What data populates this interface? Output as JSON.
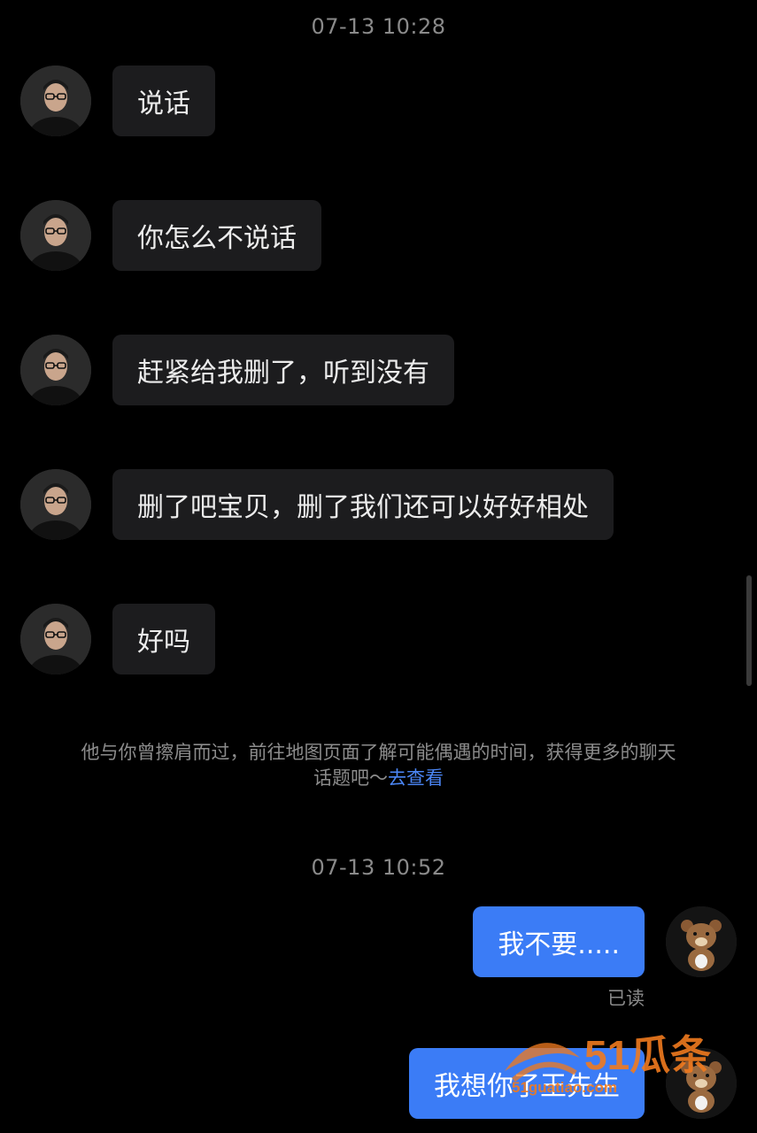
{
  "timestamps": {
    "first": "07-13 10:28",
    "second": "07-13 10:52"
  },
  "received_messages": [
    {
      "text": "说话"
    },
    {
      "text": "你怎么不说话"
    },
    {
      "text": "赶紧给我删了，听到没有"
    },
    {
      "text": "删了吧宝贝，删了我们还可以好好相处"
    },
    {
      "text": "好吗"
    }
  ],
  "hint": {
    "text": "他与你曾擦肩而过，前往地图页面了解可能偶遇的时间，获得更多的聊天话题吧～",
    "link_text": "去查看"
  },
  "sent_messages": [
    {
      "text": "我不要.....",
      "status": "已读"
    },
    {
      "text": "我想你了王先生"
    }
  ],
  "watermark": {
    "brand": "51瓜条",
    "domain": "51guatiao.com"
  },
  "colors": {
    "background": "#000000",
    "received_bubble": "#1c1c1e",
    "sent_bubble": "#3b7cf6",
    "link": "#4b86f5",
    "watermark": "#f07a1e"
  }
}
